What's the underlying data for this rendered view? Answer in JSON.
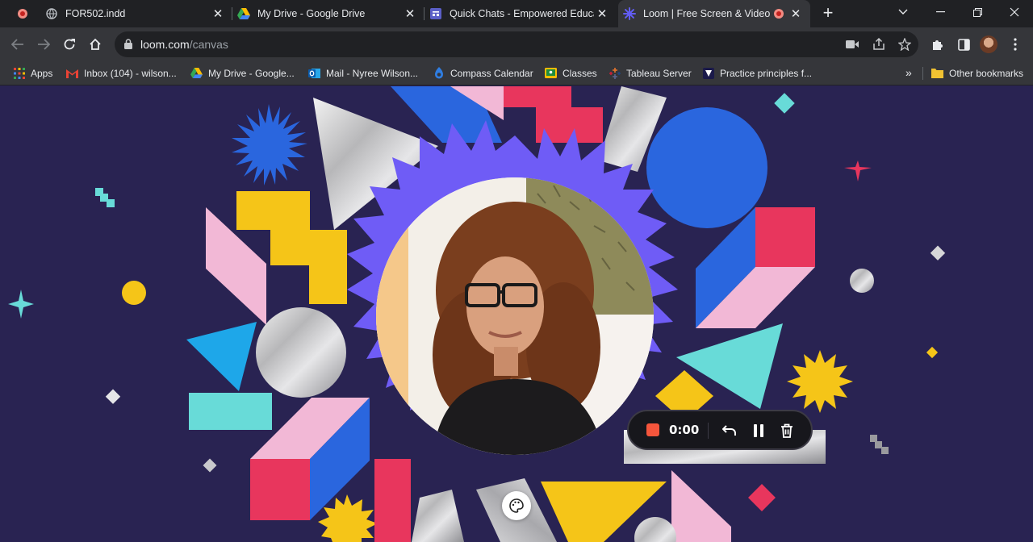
{
  "browser": {
    "tabs": [
      {
        "title": "FOR502.indd",
        "favicon": "globe-icon",
        "active": false
      },
      {
        "title": "My Drive - Google Drive",
        "favicon": "google-drive-icon",
        "active": false
      },
      {
        "title": "Quick Chats - Empowered Educat",
        "favicon": "forms-icon",
        "active": false
      },
      {
        "title": "Loom | Free Screen & Video",
        "favicon": "loom-icon",
        "active": true
      }
    ],
    "new_tab_label": "+",
    "url_host": "loom.com",
    "url_path": "/canvas",
    "bookmarks": [
      {
        "label": "Apps",
        "icon": "apps-grid-icon"
      },
      {
        "label": "Inbox (104) - wilson...",
        "icon": "gmail-icon"
      },
      {
        "label": "My Drive - Google...",
        "icon": "google-drive-icon"
      },
      {
        "label": "Mail - Nyree Wilson...",
        "icon": "outlook-icon"
      },
      {
        "label": "Compass Calendar",
        "icon": "compass-icon"
      },
      {
        "label": "Classes",
        "icon": "classroom-icon"
      },
      {
        "label": "Tableau Server",
        "icon": "tableau-icon"
      },
      {
        "label": "Practice principles f...",
        "icon": "bookmark-page-icon"
      }
    ],
    "bookmarks_overflow": "»",
    "other_bookmarks": "Other bookmarks"
  },
  "recorder": {
    "timer": "0:00",
    "stop_color": "#f5553c",
    "buttons": [
      "stop-icon",
      "undo-icon",
      "pause-icon",
      "trash-icon"
    ]
  },
  "colors": {
    "background": "#292352",
    "accent_purple": "#6f5cf6",
    "yellow": "#f5c518",
    "pink": "#f2b8d6",
    "blue": "#2a66de",
    "red": "#e8365d",
    "teal": "#68dbd8"
  }
}
